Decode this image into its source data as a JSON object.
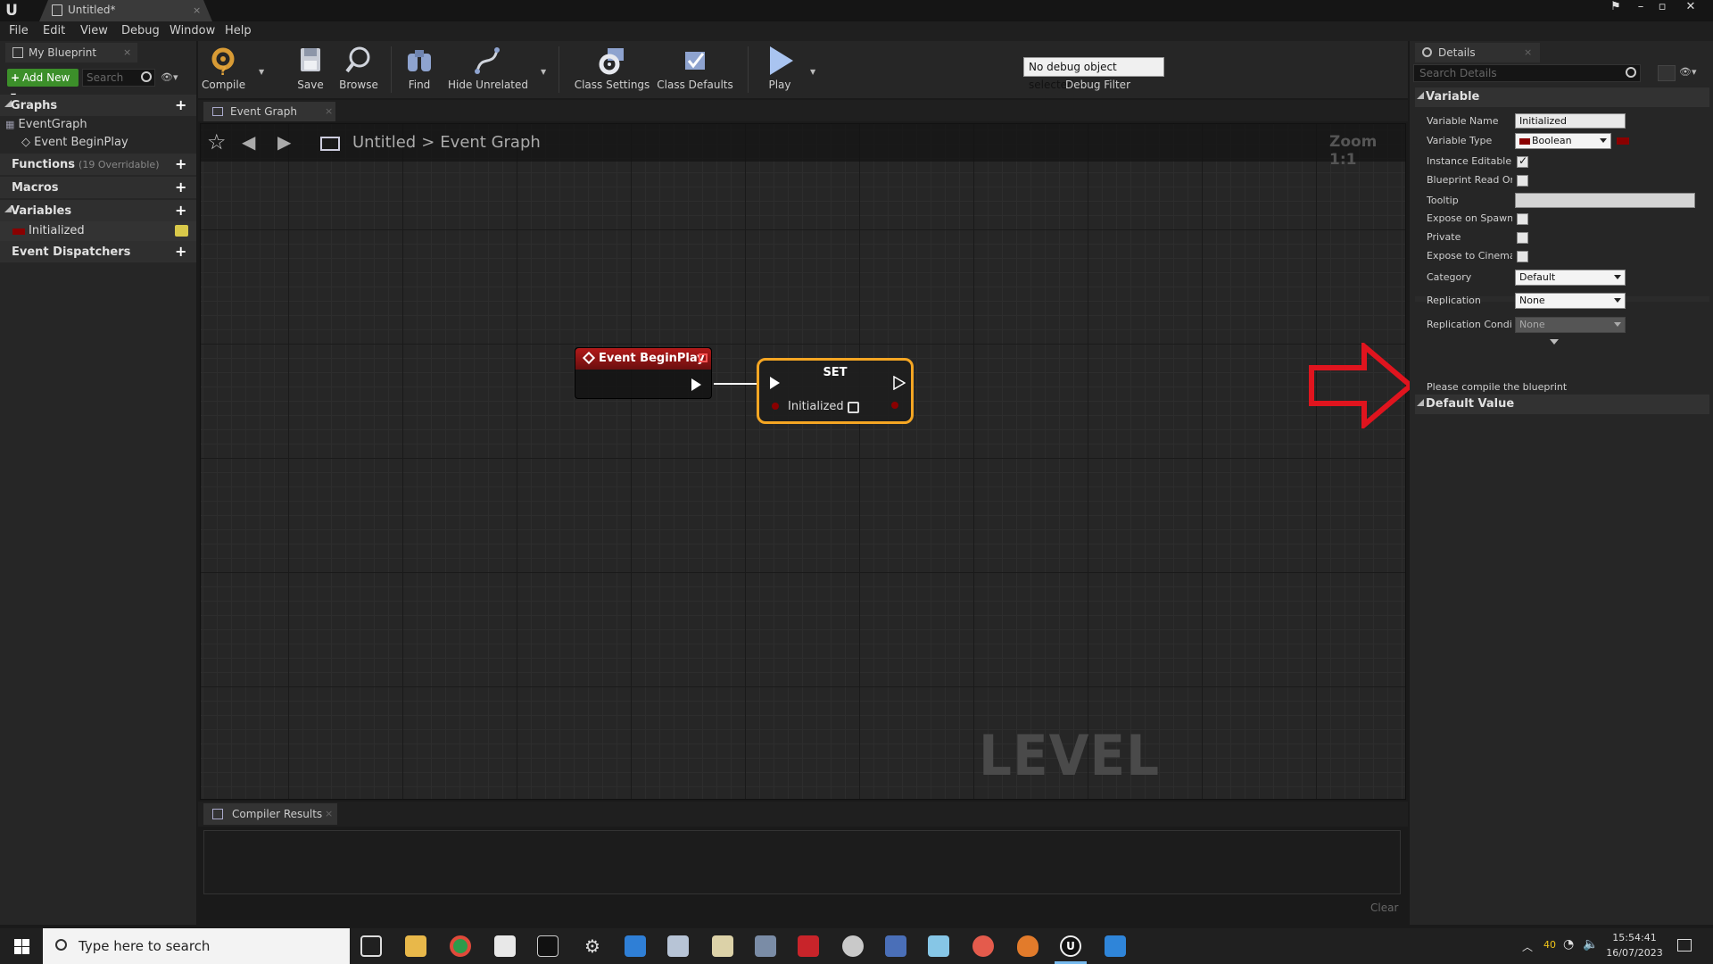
{
  "window": {
    "tab_title": "Untitled*",
    "minimize": "–",
    "maximize": "▫",
    "close": "✕"
  },
  "menu": [
    "File",
    "Edit",
    "View",
    "Debug",
    "Window",
    "Help"
  ],
  "my_blueprint": {
    "tab_label": "My Blueprint",
    "add_new": "Add New",
    "search_placeholder": "Search",
    "sections": {
      "graphs": "Graphs",
      "functions": "Functions",
      "functions_sub": "(19 Overridable)",
      "macros": "Macros",
      "variables": "Variables",
      "event_dispatchers": "Event Dispatchers"
    },
    "tree": {
      "event_graph": "EventGraph",
      "event_begin_play": "Event BeginPlay",
      "variable_initialized": "Initialized"
    }
  },
  "toolbar": {
    "compile": "Compile",
    "save": "Save",
    "browse": "Browse",
    "find": "Find",
    "hide_unrelated": "Hide Unrelated",
    "class_settings": "Class Settings",
    "class_defaults": "Class Defaults",
    "play": "Play",
    "debug_object": "No debug object selected",
    "debug_filter": "Debug Filter"
  },
  "graph": {
    "tab_label": "Event Graph",
    "breadcrumb_root": "Untitled",
    "breadcrumb_sep": ">",
    "breadcrumb_current": "Event Graph",
    "zoom": "Zoom 1:1",
    "watermark": "LEVEL BLUEPRINT",
    "node_begin_play": "Event BeginPlay",
    "node_set_title": "SET",
    "node_set_pin": "Initialized"
  },
  "compiler": {
    "tab_label": "Compiler Results",
    "clear": "Clear"
  },
  "details": {
    "tab_label": "Details",
    "search_placeholder": "Search Details",
    "section_variable": "Variable",
    "section_default": "Default Value",
    "labels": {
      "variable_name": "Variable Name",
      "variable_type": "Variable Type",
      "instance_editable": "Instance Editable",
      "blueprint_read_only": "Blueprint Read Onl",
      "tooltip": "Tooltip",
      "expose_on_spawn": "Expose on Spawn",
      "private": "Private",
      "expose_to_cinematics": "Expose to Cinemat",
      "category": "Category",
      "replication": "Replication",
      "replication_condition": "Replication Conditi"
    },
    "values": {
      "variable_name": "Initialized",
      "variable_type": "Boolean",
      "tooltip": "",
      "category": "Default",
      "replication": "None",
      "replication_condition": "None"
    },
    "checks": {
      "instance_editable": true,
      "blueprint_read_only": false,
      "expose_on_spawn": false,
      "private": false,
      "expose_to_cinematics": false
    },
    "default_message": "Please compile the blueprint"
  },
  "taskbar": {
    "search_placeholder": "Type here to search",
    "temp": "40",
    "time": "15:54:41",
    "date": "16/07/2023"
  },
  "colors": {
    "bool_pin": "#8a0000",
    "set_node_border": "#f5a623",
    "event_header": "#b21a1a",
    "annotation_arrow": "#e0141e",
    "add_new": "#3c8f2a"
  }
}
